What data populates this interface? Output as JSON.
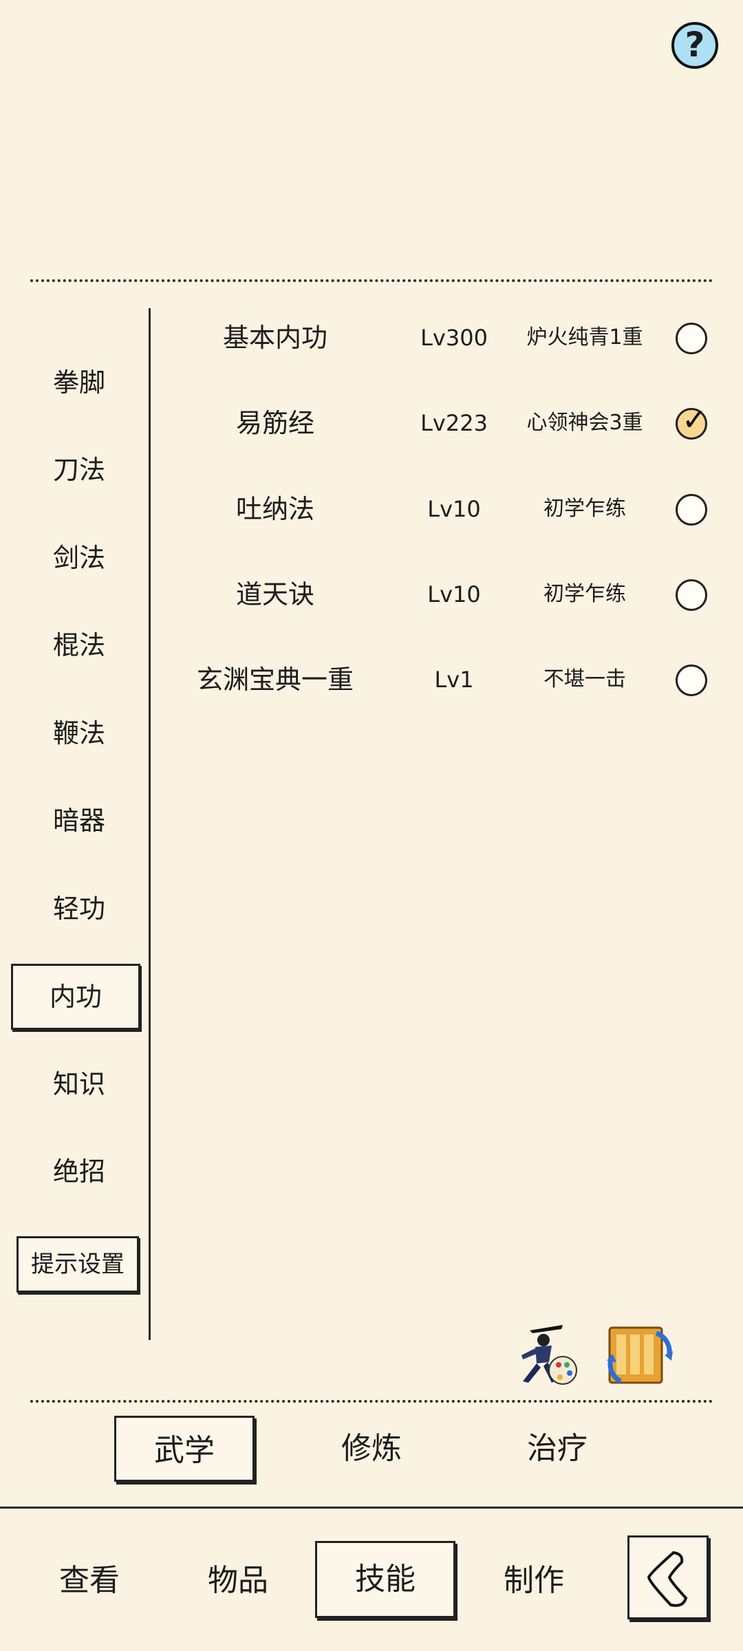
{
  "help": {
    "label": "?"
  },
  "categories": [
    "拳脚",
    "刀法",
    "剑法",
    "棍法",
    "鞭法",
    "暗器",
    "轻功",
    "内功",
    "知识",
    "绝招"
  ],
  "active_category": "内功",
  "tip_settings": "提示设置",
  "skills": [
    {
      "name": "基本内功",
      "level": "Lv300",
      "rank": "炉火纯青1重",
      "equipped": false
    },
    {
      "name": "易筋经",
      "level": "Lv223",
      "rank": "心领神会3重",
      "equipped": true
    },
    {
      "name": "吐纳法",
      "level": "Lv10",
      "rank": "初学乍练",
      "equipped": false
    },
    {
      "name": "道天诀",
      "level": "Lv10",
      "rank": "初学乍练",
      "equipped": false
    },
    {
      "name": "玄渊宝典一重",
      "level": "Lv1",
      "rank": "不堪一击",
      "equipped": false
    }
  ],
  "tabs": [
    "武学",
    "修炼",
    "治疗"
  ],
  "active_tab": "武学",
  "bottom_nav": [
    "查看",
    "物品",
    "技能",
    "制作"
  ],
  "active_nav": "技能",
  "icons": [
    "martial-artist-palette-icon",
    "scroll-swap-icon",
    "back-icon"
  ]
}
